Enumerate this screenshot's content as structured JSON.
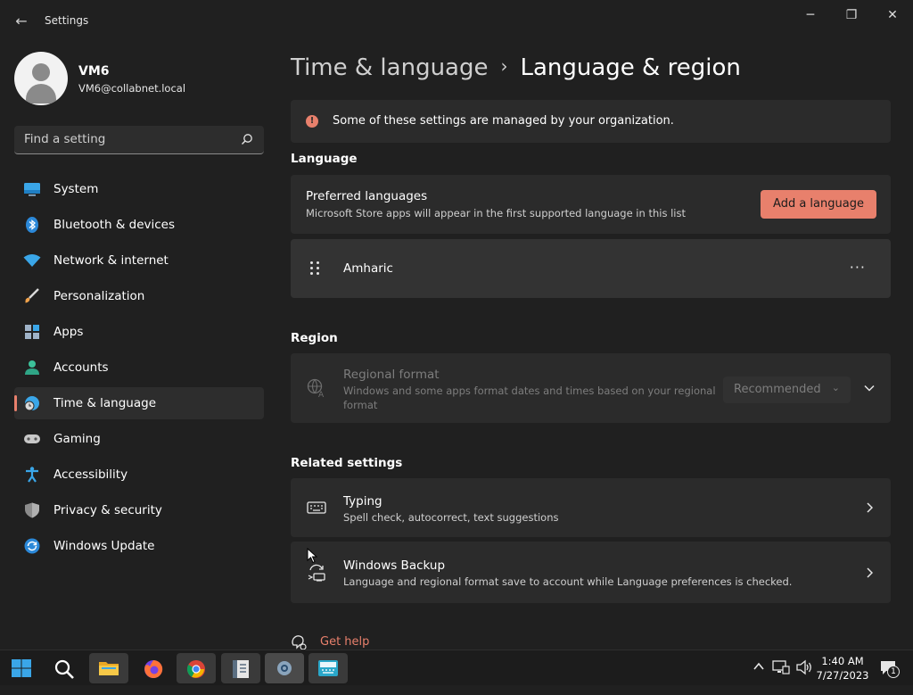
{
  "window": {
    "title": "Settings",
    "back": "←",
    "minimize": "─",
    "maximize": "❐",
    "close": "✕"
  },
  "user": {
    "name": "VM6",
    "email": "VM6@collabnet.local"
  },
  "search": {
    "placeholder": "Find a setting"
  },
  "nav": [
    {
      "label": "System",
      "icon": "monitor-icon"
    },
    {
      "label": "Bluetooth & devices",
      "icon": "bluetooth-icon"
    },
    {
      "label": "Network & internet",
      "icon": "wifi-icon"
    },
    {
      "label": "Personalization",
      "icon": "brush-icon"
    },
    {
      "label": "Apps",
      "icon": "apps-icon"
    },
    {
      "label": "Accounts",
      "icon": "person-icon"
    },
    {
      "label": "Time & language",
      "icon": "globe-clock-icon",
      "active": true
    },
    {
      "label": "Gaming",
      "icon": "gamepad-icon"
    },
    {
      "label": "Accessibility",
      "icon": "accessibility-icon"
    },
    {
      "label": "Privacy & security",
      "icon": "shield-icon"
    },
    {
      "label": "Windows Update",
      "icon": "update-icon"
    }
  ],
  "breadcrumb": {
    "parent": "Time & language",
    "separator": "›",
    "current": "Language & region"
  },
  "notice": {
    "text": "Some of these settings are managed by your organization.",
    "icon": "!"
  },
  "language": {
    "section": "Language",
    "preferred_title": "Preferred languages",
    "preferred_desc": "Microsoft Store apps will appear in the first supported language in this list",
    "add_button": "Add a language",
    "items": [
      {
        "name": "Amharic",
        "more": "···"
      }
    ]
  },
  "region": {
    "section": "Region",
    "format_title": "Regional format",
    "format_desc_1": "Windows and some apps format dates and times based on your regional",
    "format_desc_2": "format",
    "dropdown_value": "Recommended"
  },
  "related": {
    "section": "Related settings",
    "typing_title": "Typing",
    "typing_desc": "Spell check, autocorrect, text suggestions",
    "backup_title": "Windows Backup",
    "backup_desc": "Language and regional format save to account while Language preferences is checked."
  },
  "help": {
    "label": "Get help"
  },
  "taskbar": {
    "time": "1:40 AM",
    "date": "7/27/2023",
    "notifications": "1"
  },
  "colors": {
    "accent": "#e8806c",
    "background": "#202020",
    "card": "#2b2b2b"
  }
}
